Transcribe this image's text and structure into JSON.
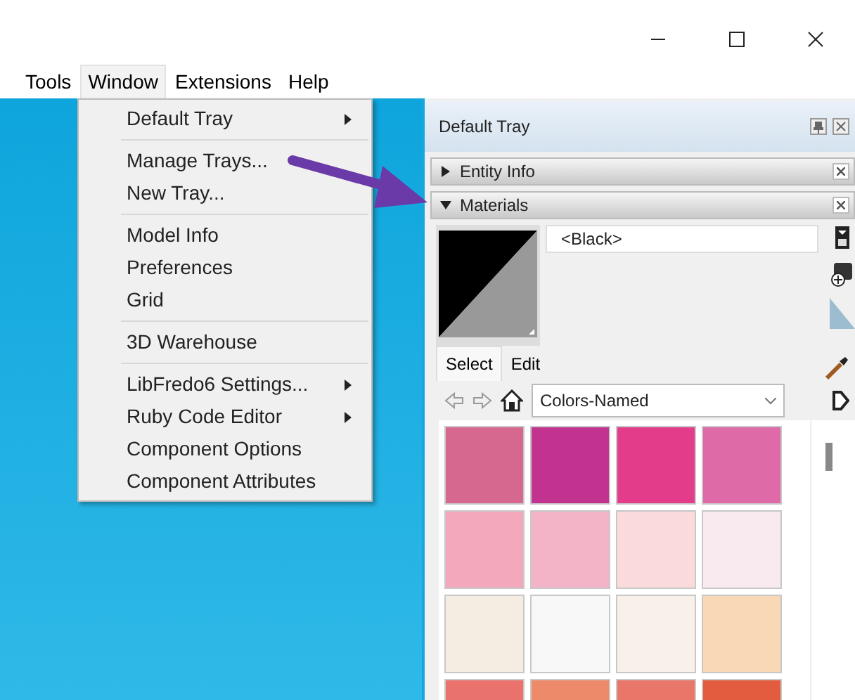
{
  "menu_bar": [
    {
      "label": "Tools",
      "selected": false
    },
    {
      "label": "Window",
      "selected": true
    },
    {
      "label": "Extensions",
      "selected": false
    },
    {
      "label": "Help",
      "selected": false
    }
  ],
  "window_menu": {
    "groups": [
      [
        {
          "label": "Default Tray",
          "submenu": true
        }
      ],
      [
        {
          "label": "Manage Trays...",
          "submenu": false
        },
        {
          "label": "New Tray...",
          "submenu": false
        }
      ],
      [
        {
          "label": "Model Info",
          "submenu": false
        },
        {
          "label": "Preferences",
          "submenu": false
        },
        {
          "label": "Grid",
          "submenu": false
        }
      ],
      [
        {
          "label": "3D Warehouse",
          "submenu": false
        }
      ],
      [
        {
          "label": "LibFredo6 Settings...",
          "submenu": true
        },
        {
          "label": "Ruby Code Editor",
          "submenu": true
        },
        {
          "label": "Component Options",
          "submenu": false
        },
        {
          "label": "Component Attributes",
          "submenu": false
        }
      ]
    ]
  },
  "tray": {
    "title": "Default Tray",
    "sections": [
      {
        "label": "Entity Info",
        "expanded": false
      },
      {
        "label": "Materials",
        "expanded": true
      }
    ],
    "material_name": "<Black>",
    "tabs": [
      {
        "label": "Select",
        "selected": true
      },
      {
        "label": "Edit",
        "selected": false
      }
    ],
    "library": "Colors-Named",
    "swatches": [
      {
        "color": "#d6688f"
      },
      {
        "color": "#c2338f"
      },
      {
        "color": "#e23c8a"
      },
      {
        "color": "#de6aa8"
      },
      {
        "color": "#f3a9bb"
      },
      {
        "color": "#f2b4c6"
      },
      {
        "color": "#fbdadb"
      },
      {
        "color": "#f8eaef"
      },
      {
        "color": "#f5ece2"
      },
      {
        "color": "#f8f8f8"
      },
      {
        "color": "#f8f1ea"
      },
      {
        "color": "#f8d8b5"
      },
      {
        "color": "#e9736c"
      },
      {
        "color": "#ec8a6a"
      },
      {
        "color": "#e8776a"
      },
      {
        "color": "#e35c40"
      }
    ]
  }
}
